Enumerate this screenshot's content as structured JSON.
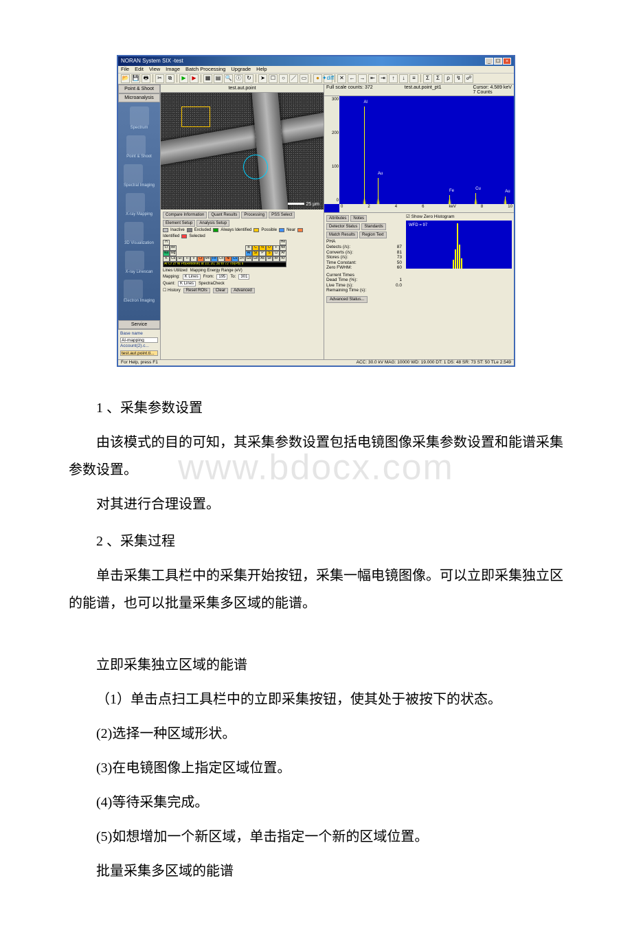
{
  "app": {
    "title": "NORAN System SIX -test",
    "menu": [
      "File",
      "Edit",
      "View",
      "Image",
      "Batch Processing",
      "Upgrade",
      "Help"
    ],
    "left_tabs": [
      "Point & Shoot",
      "Microanalysis"
    ],
    "nav_icons": [
      "Spectrum",
      "Point & Shoot",
      "Spectral Imaging",
      "X-ray Mapping",
      "3D Visualization",
      "X-ray Linescan",
      "Electron Imaging"
    ],
    "service_label": "Service",
    "base_name_label": "Base name",
    "base_name_value": "Al-mapping",
    "account_label": "Account(2).c...",
    "account_value": "test.aut.point.ti..."
  },
  "image_pane": {
    "title": "test.aut.point",
    "scale": "25 µm"
  },
  "lower_left": {
    "tabs_row1": [
      "Compare Information",
      "Quant Results",
      "Processing",
      "PSS Select"
    ],
    "tabs_row2": [
      "Element Setup",
      "Analysis Setup"
    ],
    "legend": [
      {
        "color": "#c0c0c0",
        "label": "Inactive"
      },
      {
        "color": "#808080",
        "label": "Excluded"
      },
      {
        "color": "#00a000",
        "label": "Always Identified"
      },
      {
        "color": "#ffc800",
        "label": "Possible"
      },
      {
        "color": "#4090ff",
        "label": "Near"
      },
      {
        "color": "#ff8040",
        "label": "Identified"
      },
      {
        "color": "#ff4040",
        "label": "Selected"
      }
    ],
    "formula": "Al Cr Zr Ni Pb(Resolve) at 10, 20, 30 to 72 ToI(Pb) s",
    "lines_label": "Lines Utilized",
    "energy_label": "Mapping Energy Range (eV)",
    "mapping_label": "Mapping:",
    "mapping_value": "K Lines",
    "from_label": "From:",
    "from_value": "195",
    "to_label": "To:",
    "to_value": "301",
    "quant_label": "Quant:",
    "quant_value": "K Lines",
    "spectra_label": "SpectraCheck",
    "history_label": "History",
    "buttons": [
      "Reset ROIs",
      "Clear",
      "Advanced"
    ]
  },
  "spectrum": {
    "header_left": "Full scale counts: 372",
    "header_mid": "test.aut.point_pt1",
    "header_right1": "Cursor:",
    "header_right2": "4.589 keV",
    "header_right3": "7 Counts",
    "yticks": [
      "300",
      "200",
      "100",
      "0"
    ],
    "xticks": [
      "0",
      "2",
      "4",
      "6",
      "8",
      "10"
    ],
    "xlabel": "keV",
    "peaks": [
      {
        "x_pct": 14,
        "h_pct": 90,
        "label": "Al"
      },
      {
        "x_pct": 22,
        "h_pct": 24,
        "label": "Au"
      },
      {
        "x_pct": 63,
        "h_pct": 8,
        "label": "Fe"
      },
      {
        "x_pct": 78,
        "h_pct": 10,
        "label": "Cu"
      },
      {
        "x_pct": 95,
        "h_pct": 7,
        "label": "Au"
      }
    ]
  },
  "lower_right": {
    "tabs": [
      "Attributes",
      "Notes",
      "Detector Status",
      "Standards",
      "Match Results",
      "Region Text"
    ],
    "pha_label": "PHA",
    "show_zero_label": "Show Zero Histogram",
    "wfd_label": "WFD = 97",
    "rows": [
      {
        "k": "Detects (/s):",
        "v": "87"
      },
      {
        "k": "Converts (/s):",
        "v": "81"
      },
      {
        "k": "Stores (/s):",
        "v": "73"
      },
      {
        "k": "Time Constant:",
        "v": "50"
      },
      {
        "k": "Zero FWHM:",
        "v": "60"
      }
    ],
    "current_label": "Current Times",
    "rows2": [
      {
        "k": "Dead Time (%):",
        "v": "1"
      },
      {
        "k": "Live Time (s):",
        "v": "0.0"
      },
      {
        "k": "Remaining Time (s):",
        "v": ""
      }
    ],
    "adv_button": "Advanced Status..."
  },
  "statusbar": {
    "left": "For Help, press F1",
    "right": "ACC: 30.0 kV   MAG: 10000   WD: 19.000   DT: 1   DS: 48   SR: 73   ST: 50   TLe 2.549"
  },
  "doc": {
    "h1": "1 、采集参数设置",
    "p1": "由该模式的目的可知，其采集参数设置包括电镜图像采集参数设置和能谱采集参数设置。",
    "p1b": "对其进行合理设置。",
    "h2": "2 、采集过程",
    "p2": "单击采集工具栏中的采集开始按钮，采集一幅电镜图像。可以立即采集独立区的能谱，也可以批量采集多区域的能谱。",
    "p3": "立即采集独立区域的能谱",
    "p4": "（1）单击点扫工具栏中的立即采集按钮，使其处于被按下的状态。",
    "p5": "(2)选择一种区域形状。",
    "p6": "(3)在电镜图像上指定区域位置。",
    "p7": "(4)等待采集完成。",
    "p8": "(5)如想增加一个新区域，单击指定一个新的区域位置。",
    "p9": "批量采集多区域的能谱"
  },
  "watermark": "www.bdocx.com"
}
